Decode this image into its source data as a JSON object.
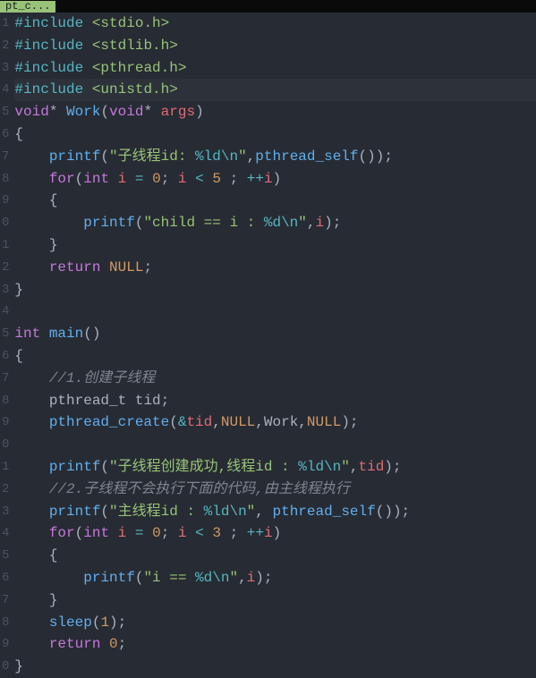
{
  "tab": {
    "label": "pt_c..."
  },
  "gutter": {
    "1": "1",
    "2": "2",
    "3": "3",
    "4": "4",
    "5": "5",
    "6": "6",
    "7": "7",
    "8": "8",
    "9": "9",
    "10": "0",
    "11": "1",
    "12": "2",
    "13": "3",
    "14": "4",
    "15": "5",
    "16": "6",
    "17": "7",
    "18": "8",
    "19": "9",
    "20": "0",
    "21": "1",
    "22": "2",
    "23": "3",
    "24": "4",
    "25": "5",
    "26": "6",
    "27": "7",
    "28": "8",
    "29": "9",
    "30": "0"
  },
  "t": {
    "include": "#include",
    "stdio": "<stdio.h>",
    "stdlib": "<stdlib.h>",
    "pthread_h": "<pthread.h>",
    "unistd": "<unistd.h>",
    "void": "void",
    "star": "*",
    "work": "Work",
    "args": "args",
    "lp": "(",
    "rp": ")",
    "lb": "{",
    "rb": "}",
    "printf": "printf",
    "s_child_id": "\"子线程id: ",
    "pct_ld": "%ld",
    "nl": "\\n",
    "q": "\"",
    "comma": ",",
    "pthread_self": "pthread_self",
    "semi": ";",
    "for": "for",
    "int": "int",
    "i": "i",
    "eq": "=",
    "zero": "0",
    "lt": "<",
    "five": "5",
    "three": "3",
    "ppi": "++",
    "s_child_eq": "\"child == i : ",
    "pct_d": "%d",
    "return": "return",
    "null": "NULL",
    "main": "main",
    "cm1": "//1.创建子线程",
    "pthread_t": "pthread_t",
    "tid": "tid",
    "pthread_create": "pthread_create",
    "amp": "&",
    "s_create_ok1": "\"子线程创建成功,线程id : ",
    "cm2": "//2.子线程不会执行下面的代码,由主线程执行",
    "s_main_id": "\"主线程id : ",
    "s_i_eq": "\"i == ",
    "sleep": "sleep",
    "one": "1",
    "space_in": " "
  }
}
